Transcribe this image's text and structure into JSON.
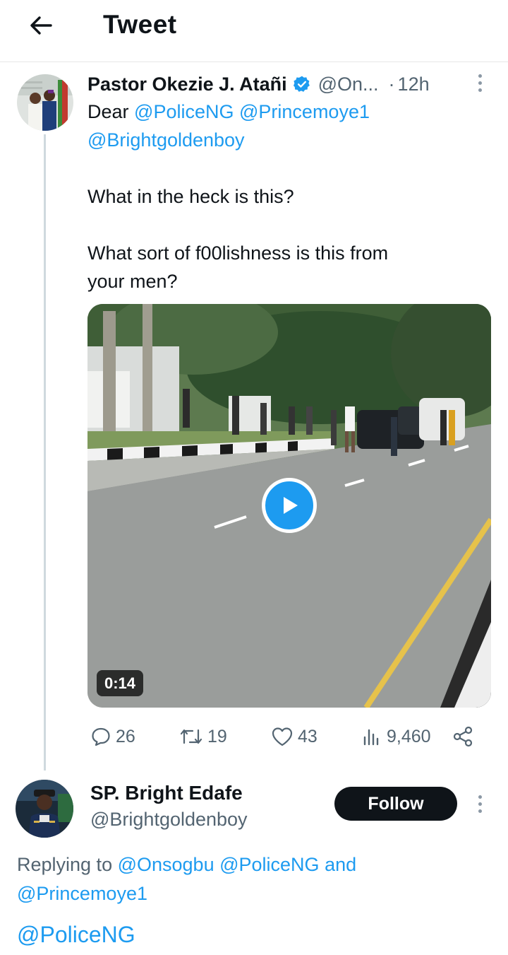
{
  "header": {
    "title": "Tweet",
    "back_icon": "arrow-left-icon"
  },
  "tweet1": {
    "author_name": "Pastor Okezie J. Atañi",
    "handle": "@On...",
    "dot": "·",
    "time": "12h",
    "verified_color": "#1d9bf0",
    "body": {
      "line1_prefix": "Dear ",
      "mention1": "@PoliceNG",
      "mention2": "@Princemoye1",
      "mention3": "@Brightgoldenboy",
      "para2": "What in the heck is this?",
      "para3_line1": "What sort of f00lishness is this from",
      "para3_line2": "your men?"
    },
    "video": {
      "duration": "0:14"
    },
    "stats": {
      "replies": "26",
      "retweets": "19",
      "likes": "43",
      "views": "9,460"
    }
  },
  "tweet2": {
    "author_name": "SP. Bright Edafe",
    "handle": "@Brightgoldenboy",
    "follow_label": "Follow",
    "replying_prefix": "Replying to ",
    "reply_mention1": "@Onsogbu",
    "reply_mention2": "@PoliceNG",
    "reply_and": " and",
    "reply_mention3": "@Princemoye1",
    "body": "@PoliceNG"
  },
  "colors": {
    "accent": "#1d9bf0",
    "text": "#0f1419",
    "muted": "#536471"
  }
}
